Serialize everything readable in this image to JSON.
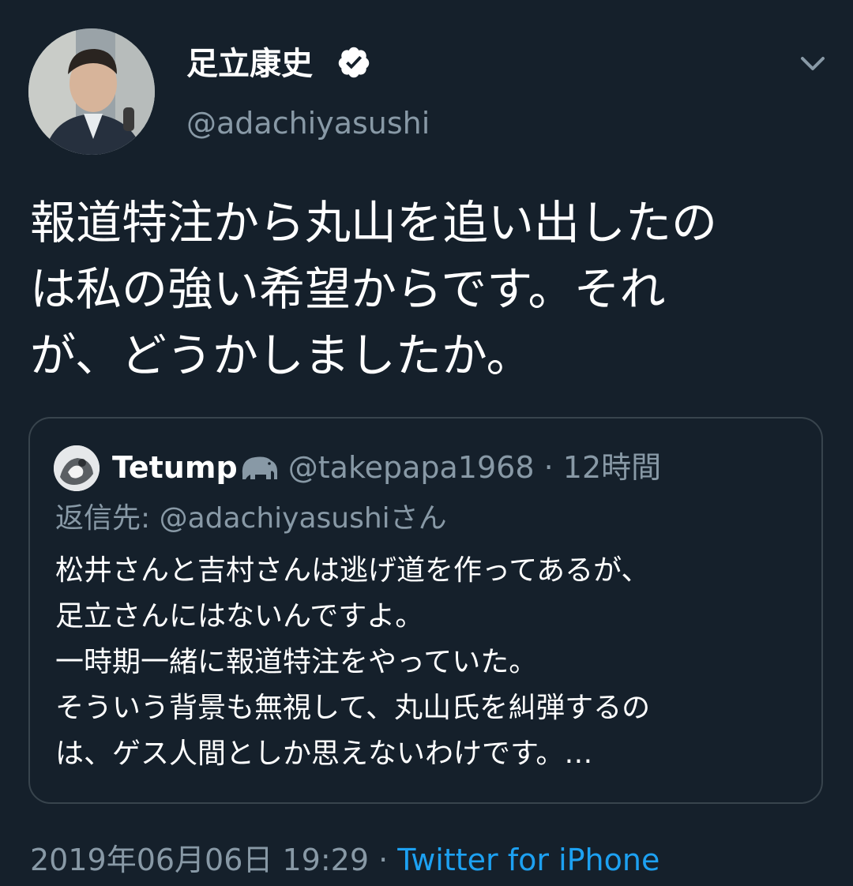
{
  "author": {
    "display_name": "足立康史",
    "handle": "@adachiyasushi",
    "verified_icon": "verified-badge-icon"
  },
  "tweet": {
    "lines": [
      "報道特注から丸山を追い出したの",
      "は私の強い希望からです。それ",
      "が、どうかしましたか。"
    ]
  },
  "quoted_tweet": {
    "display_name": "Tetump",
    "name_emoji_icon": "elephant-icon",
    "handle": "@takepapa1968",
    "separator": "·",
    "time": "12時間",
    "reply_to": "返信先: @adachiyasushiさん",
    "lines": [
      "松井さんと吉村さんは逃げ道を作ってあるが、",
      "足立さんにはないんですよ。",
      "一時期一緒に報道特注をやっていた。",
      "そういう背景も無視して、丸山氏を糾弾するの",
      "は、ゲス人間としか思えないわけです。…"
    ]
  },
  "footer": {
    "timestamp": "2019年06月06日 19:29",
    "separator": "·",
    "source": "Twitter for iPhone"
  },
  "colors": {
    "background": "#15202b",
    "text_primary": "#ffffff",
    "text_secondary": "#8899a6",
    "link": "#1da1f2",
    "border": "#38444d"
  }
}
